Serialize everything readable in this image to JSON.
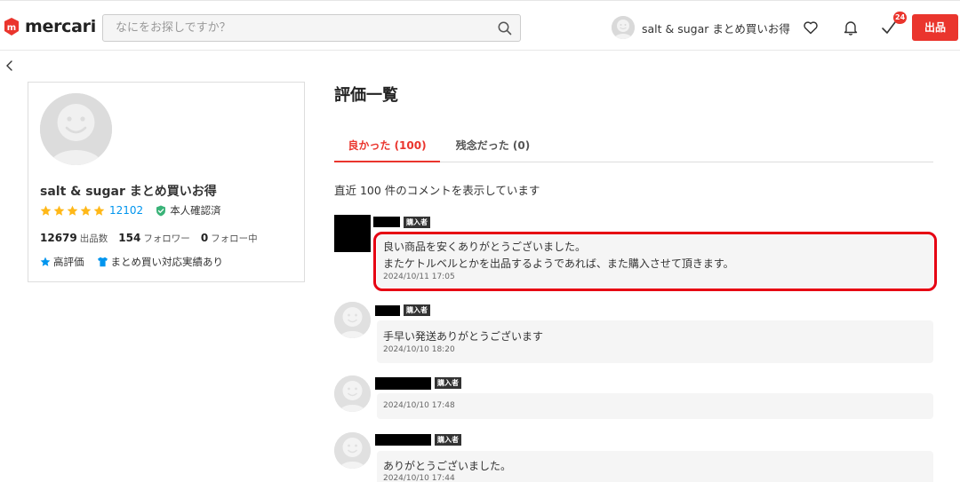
{
  "header": {
    "logo_text": "mercari",
    "search_placeholder": "なにをお探しですか？",
    "user_name": "salt & sugar まとめ買いお得",
    "badge_count": "24",
    "sell_label": "出品"
  },
  "profile": {
    "name": "salt & sugar まとめ買いお得",
    "rating_count": "12102",
    "verified_label": "本人確認済",
    "listings": {
      "value": "12679",
      "label": "出品数"
    },
    "followers": {
      "value": "154",
      "label": "フォロワー"
    },
    "following": {
      "value": "0",
      "label": "フォロー中"
    },
    "features": [
      "高評価",
      "まとめ買い対応実績あり"
    ],
    "star_count": 5
  },
  "main": {
    "title": "評価一覧",
    "tabs": [
      {
        "label": "良かった (100)",
        "active": true
      },
      {
        "label": "残念だった (0)",
        "active": false
      }
    ],
    "summary": "直近 100 件のコメントを表示しています",
    "reviews": [
      {
        "tag": "購入者",
        "lines": [
          "良い商品を安くありがとうございました。",
          "またケトルベルとかを出品するようであれば、また購入させて頂きます。"
        ],
        "date": "2024/10/11 17:05"
      },
      {
        "tag": "購入者",
        "lines": [
          "手早い発送ありがとうございます"
        ],
        "date": "2024/10/10 18:20"
      },
      {
        "tag": "購入者",
        "lines": [],
        "date": "2024/10/10 17:48"
      },
      {
        "tag": "購入者",
        "lines": [
          "ありがとうございました。"
        ],
        "date": "2024/10/10 17:44"
      }
    ]
  },
  "colors": {
    "accent": "#ea352d",
    "link": "#0095ee",
    "star": "#ffb818",
    "verified": "#3ab378",
    "highlight": "#e60012"
  },
  "icons": [
    "search-icon",
    "heart-icon",
    "bell-icon",
    "checkmark-icon",
    "chevron-left-icon",
    "star-icon",
    "shield-check-icon",
    "tshirt-icon"
  ]
}
